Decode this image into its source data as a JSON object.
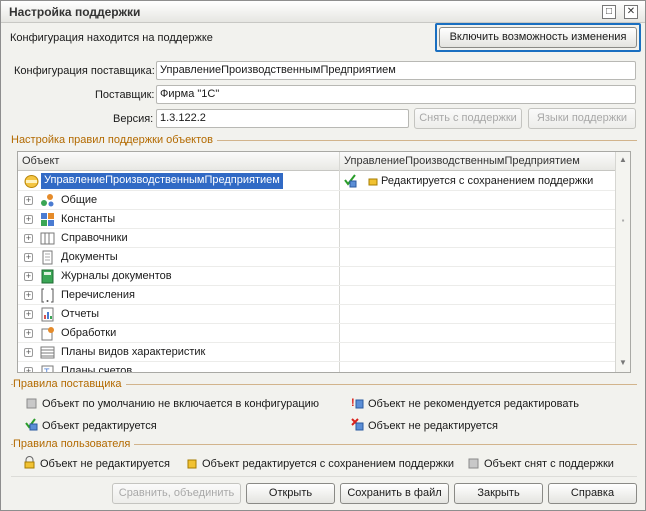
{
  "window": {
    "title": "Настройка поддержки",
    "controls": [
      "□",
      "✕"
    ]
  },
  "top": {
    "status_text": "Конфигурация находится на поддержке",
    "enable_changes_label": "Включить возможность изменения"
  },
  "info": {
    "vendor_config_label": "Конфигурация поставщика:",
    "vendor_config_value": "УправлениеПроизводственнымПредприятием",
    "vendor_label": "Поставщик:",
    "vendor_value": "Фирма \"1С\"",
    "version_label": "Версия:",
    "version_value": "1.3.122.2",
    "remove_support_label": "Снять с поддержки",
    "support_languages_label": "Языки поддержки"
  },
  "rules_group": {
    "caption": "Настройка правил поддержки объектов",
    "columns": [
      "Объект",
      "УправлениеПроизводственнымПредприятием"
    ],
    "root": {
      "name": "УправлениеПроизводственнымПредприятием",
      "rule": "Редактируется с сохранением поддержки"
    },
    "items": [
      {
        "name": "Общие",
        "icon": "common-icon"
      },
      {
        "name": "Константы",
        "icon": "constants-icon"
      },
      {
        "name": "Справочники",
        "icon": "catalogs-icon"
      },
      {
        "name": "Документы",
        "icon": "documents-icon"
      },
      {
        "name": "Журналы документов",
        "icon": "journals-icon"
      },
      {
        "name": "Перечисления",
        "icon": "enums-icon"
      },
      {
        "name": "Отчеты",
        "icon": "reports-icon"
      },
      {
        "name": "Обработки",
        "icon": "processing-icon"
      },
      {
        "name": "Планы видов характеристик",
        "icon": "chart-types-icon"
      },
      {
        "name": "Планы счетов",
        "icon": "accounts-icon"
      }
    ]
  },
  "vendor_rules": {
    "caption": "Правила поставщика",
    "items": [
      "Объект по умолчанию не включается в конфигурацию",
      "Объект не рекомендуется редактировать",
      "Объект редактируется",
      "Объект не редактируется"
    ]
  },
  "user_rules": {
    "caption": "Правила пользователя",
    "items": [
      "Объект не редактируется",
      "Объект редактируется с сохранением поддержки",
      "Объект снят с поддержки"
    ]
  },
  "buttons": {
    "compare": "Сравнить, объединить",
    "open": "Открыть",
    "save_file": "Сохранить в файл",
    "close": "Закрыть",
    "help": "Справка"
  },
  "colors": {
    "selection": "#316ac5",
    "highlight_border": "#1a6fc0",
    "group_caption": "#b36a00"
  }
}
